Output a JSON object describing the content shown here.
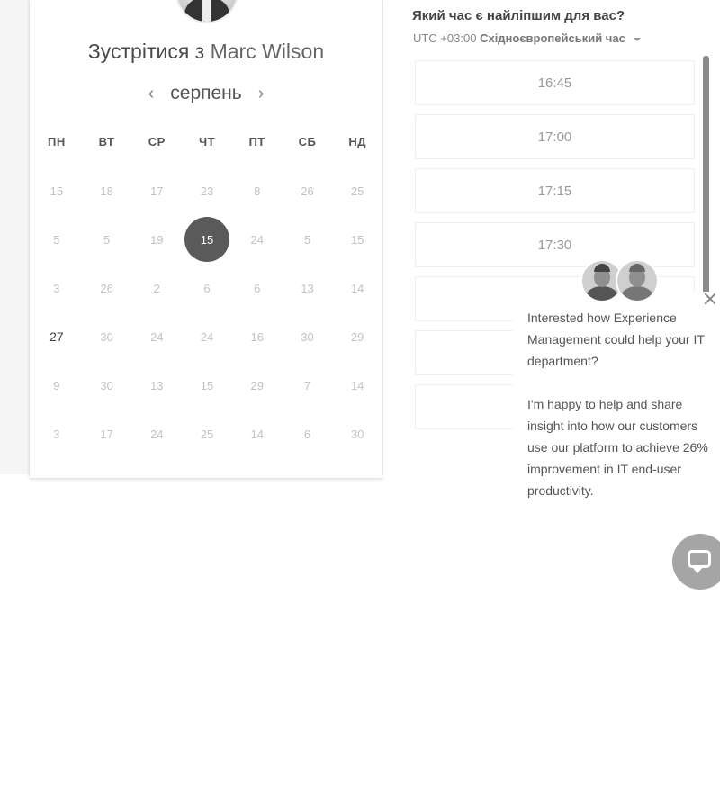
{
  "scheduler": {
    "title_prefix": "Зустрітися з",
    "host_name": "Marc Wilson",
    "month": "серпень",
    "prev_icon": "chevron-left-icon",
    "next_icon": "chevron-right-icon",
    "weekdays": [
      "ПН",
      "ВТ",
      "СР",
      "ЧТ",
      "ПТ",
      "СБ",
      "НД"
    ],
    "weeks": [
      [
        "15",
        "18",
        "17",
        "23",
        "8",
        "26",
        "25"
      ],
      [
        "5",
        "5",
        "19",
        "15",
        "24",
        "5",
        "15"
      ],
      [
        "3",
        "26",
        "2",
        "6",
        "6",
        "13",
        "14"
      ],
      [
        "27",
        "30",
        "24",
        "24",
        "16",
        "30",
        "29"
      ],
      [
        "9",
        "30",
        "13",
        "15",
        "29",
        "7",
        "14"
      ],
      [
        "3",
        "17",
        "24",
        "25",
        "14",
        "6",
        "30"
      ]
    ],
    "selected_day": "15",
    "available_day": "27"
  },
  "times": {
    "title": "Який час є найліпшим для вас?",
    "timezone_prefix": "UTC +03:00",
    "timezone_name": "Східноєвропейський час",
    "slots": [
      "16:45",
      "17:00",
      "17:15",
      "17:30",
      "",
      "",
      ""
    ]
  },
  "chat_popup": {
    "message_1": "Interested how Experience Management could help your IT department?",
    "message_2": "I'm happy to help and share insight into how our customers use our platform to achieve 26% improvement in IT end-user productivity.",
    "close_icon": "close-icon",
    "launcher_icon": "chat-icon"
  },
  "colors": {
    "selected_day": "#5a5a5a",
    "muted_day": "#c2c2c2",
    "launcher": "#a5a5a5"
  }
}
